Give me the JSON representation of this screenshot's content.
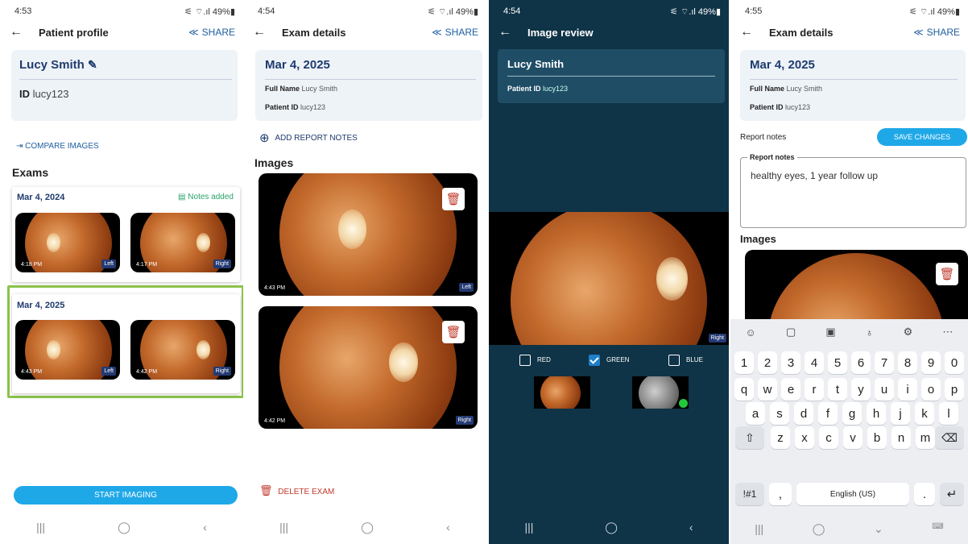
{
  "s1": {
    "time": "4:53",
    "battery": "49%",
    "title": "Patient profile",
    "share": "SHARE",
    "patient_name": "Lucy Smith",
    "id_label": "ID",
    "id_value": "lucy123",
    "compare": "COMPARE IMAGES",
    "exams_heading": "Exams",
    "exams": [
      {
        "date": "Mar 4, 2024",
        "notes": "Notes added",
        "left_time": "4:18 PM",
        "left_tag": "Left",
        "right_time": "4:17 PM",
        "right_tag": "Right"
      },
      {
        "date": "Mar 4, 2025",
        "left_time": "4:43 PM",
        "left_tag": "Left",
        "right_time": "4:42 PM",
        "right_tag": "Right"
      }
    ],
    "start": "START IMAGING"
  },
  "s2": {
    "time": "4:54",
    "battery": "49%",
    "title": "Exam details",
    "share": "SHARE",
    "date": "Mar 4, 2025",
    "full_name_label": "Full Name",
    "full_name": "Lucy Smith",
    "patient_id_label": "Patient ID",
    "patient_id": "lucy123",
    "add_notes": "ADD REPORT NOTES",
    "images_heading": "Images",
    "img1_time": "4:43 PM",
    "img1_tag": "Left",
    "img2_time": "4:42 PM",
    "img2_tag": "Right",
    "delete": "DELETE EXAM"
  },
  "s3": {
    "time": "4:54",
    "battery": "49%",
    "title": "Image review",
    "patient_name": "Lucy Smith",
    "patient_id_label": "Patient ID",
    "patient_id": "lucy123",
    "img_tag": "Right",
    "channels": [
      {
        "label": "RED",
        "checked": false
      },
      {
        "label": "GREEN",
        "checked": true
      },
      {
        "label": "BLUE",
        "checked": false
      }
    ]
  },
  "s4": {
    "time": "4:55",
    "battery": "49%",
    "title": "Exam details",
    "share": "SHARE",
    "date": "Mar 4, 2025",
    "full_name_label": "Full Name",
    "full_name": "Lucy Smith",
    "patient_id_label": "Patient ID",
    "patient_id": "lucy123",
    "report_notes": "Report notes",
    "save": "SAVE CHANGES",
    "field_label": "Report notes",
    "notes_value": "healthy eyes, 1 year follow up",
    "images_heading": "Images",
    "keyboard": {
      "numbers": [
        "1",
        "2",
        "3",
        "4",
        "5",
        "6",
        "7",
        "8",
        "9",
        "0"
      ],
      "row1": [
        "q",
        "w",
        "e",
        "r",
        "t",
        "y",
        "u",
        "i",
        "o",
        "p"
      ],
      "row2": [
        "a",
        "s",
        "d",
        "f",
        "g",
        "h",
        "j",
        "k",
        "l"
      ],
      "row3": [
        "z",
        "x",
        "c",
        "v",
        "b",
        "n",
        "m"
      ],
      "sym": "!#1",
      "comma": ",",
      "space": "English (US)",
      "period": "."
    }
  },
  "accent": "#1fa8e8",
  "brand_navy": "#1f3b6e",
  "danger": "#c0392b",
  "notes_green": "#27a36b"
}
